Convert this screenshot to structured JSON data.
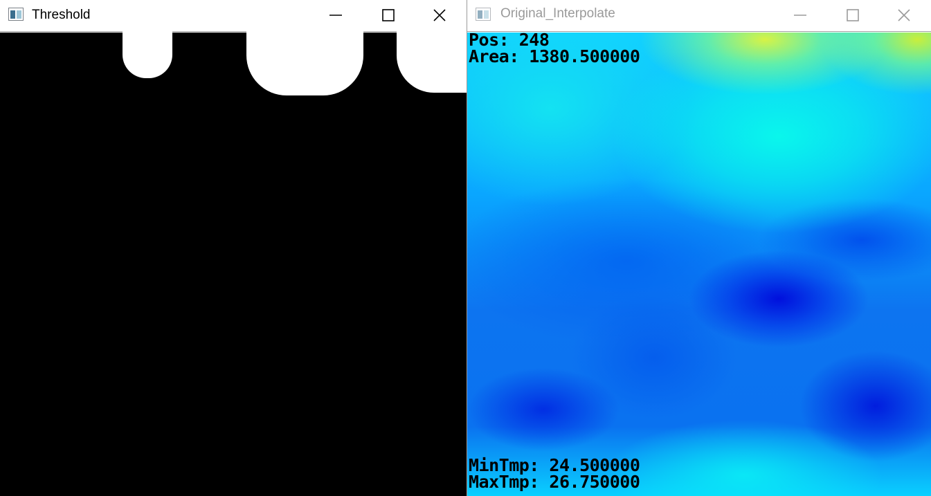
{
  "windows": [
    {
      "title": "Threshold",
      "state": "active",
      "icon": "app-window-icon",
      "controls": [
        "minimize-icon",
        "maximize-icon",
        "close-icon"
      ]
    },
    {
      "title": "Original_Interpolate",
      "state": "inactive",
      "icon": "app-window-icon",
      "controls": [
        "minimize-icon",
        "maximize-icon",
        "close-icon"
      ],
      "overlay": {
        "pos": "Pos: 248",
        "area": "Area: 1380.500000",
        "min_tmp": "MinTmp: 24.500000",
        "max_tmp": "MaxTmp: 26.750000"
      }
    }
  ],
  "colors": {
    "titlebar_active_text": "#000000",
    "titlebar_inactive_text": "#9a9a9a",
    "threshold_background": "#000000",
    "threshold_foreground": "#ffffff",
    "heatmap_cold": "#0010e0",
    "heatmap_mid": "#00a0ff",
    "heatmap_warm": "#10f5ea",
    "heatmap_hot": "#d8f23a",
    "overlay_text": "#000000"
  }
}
